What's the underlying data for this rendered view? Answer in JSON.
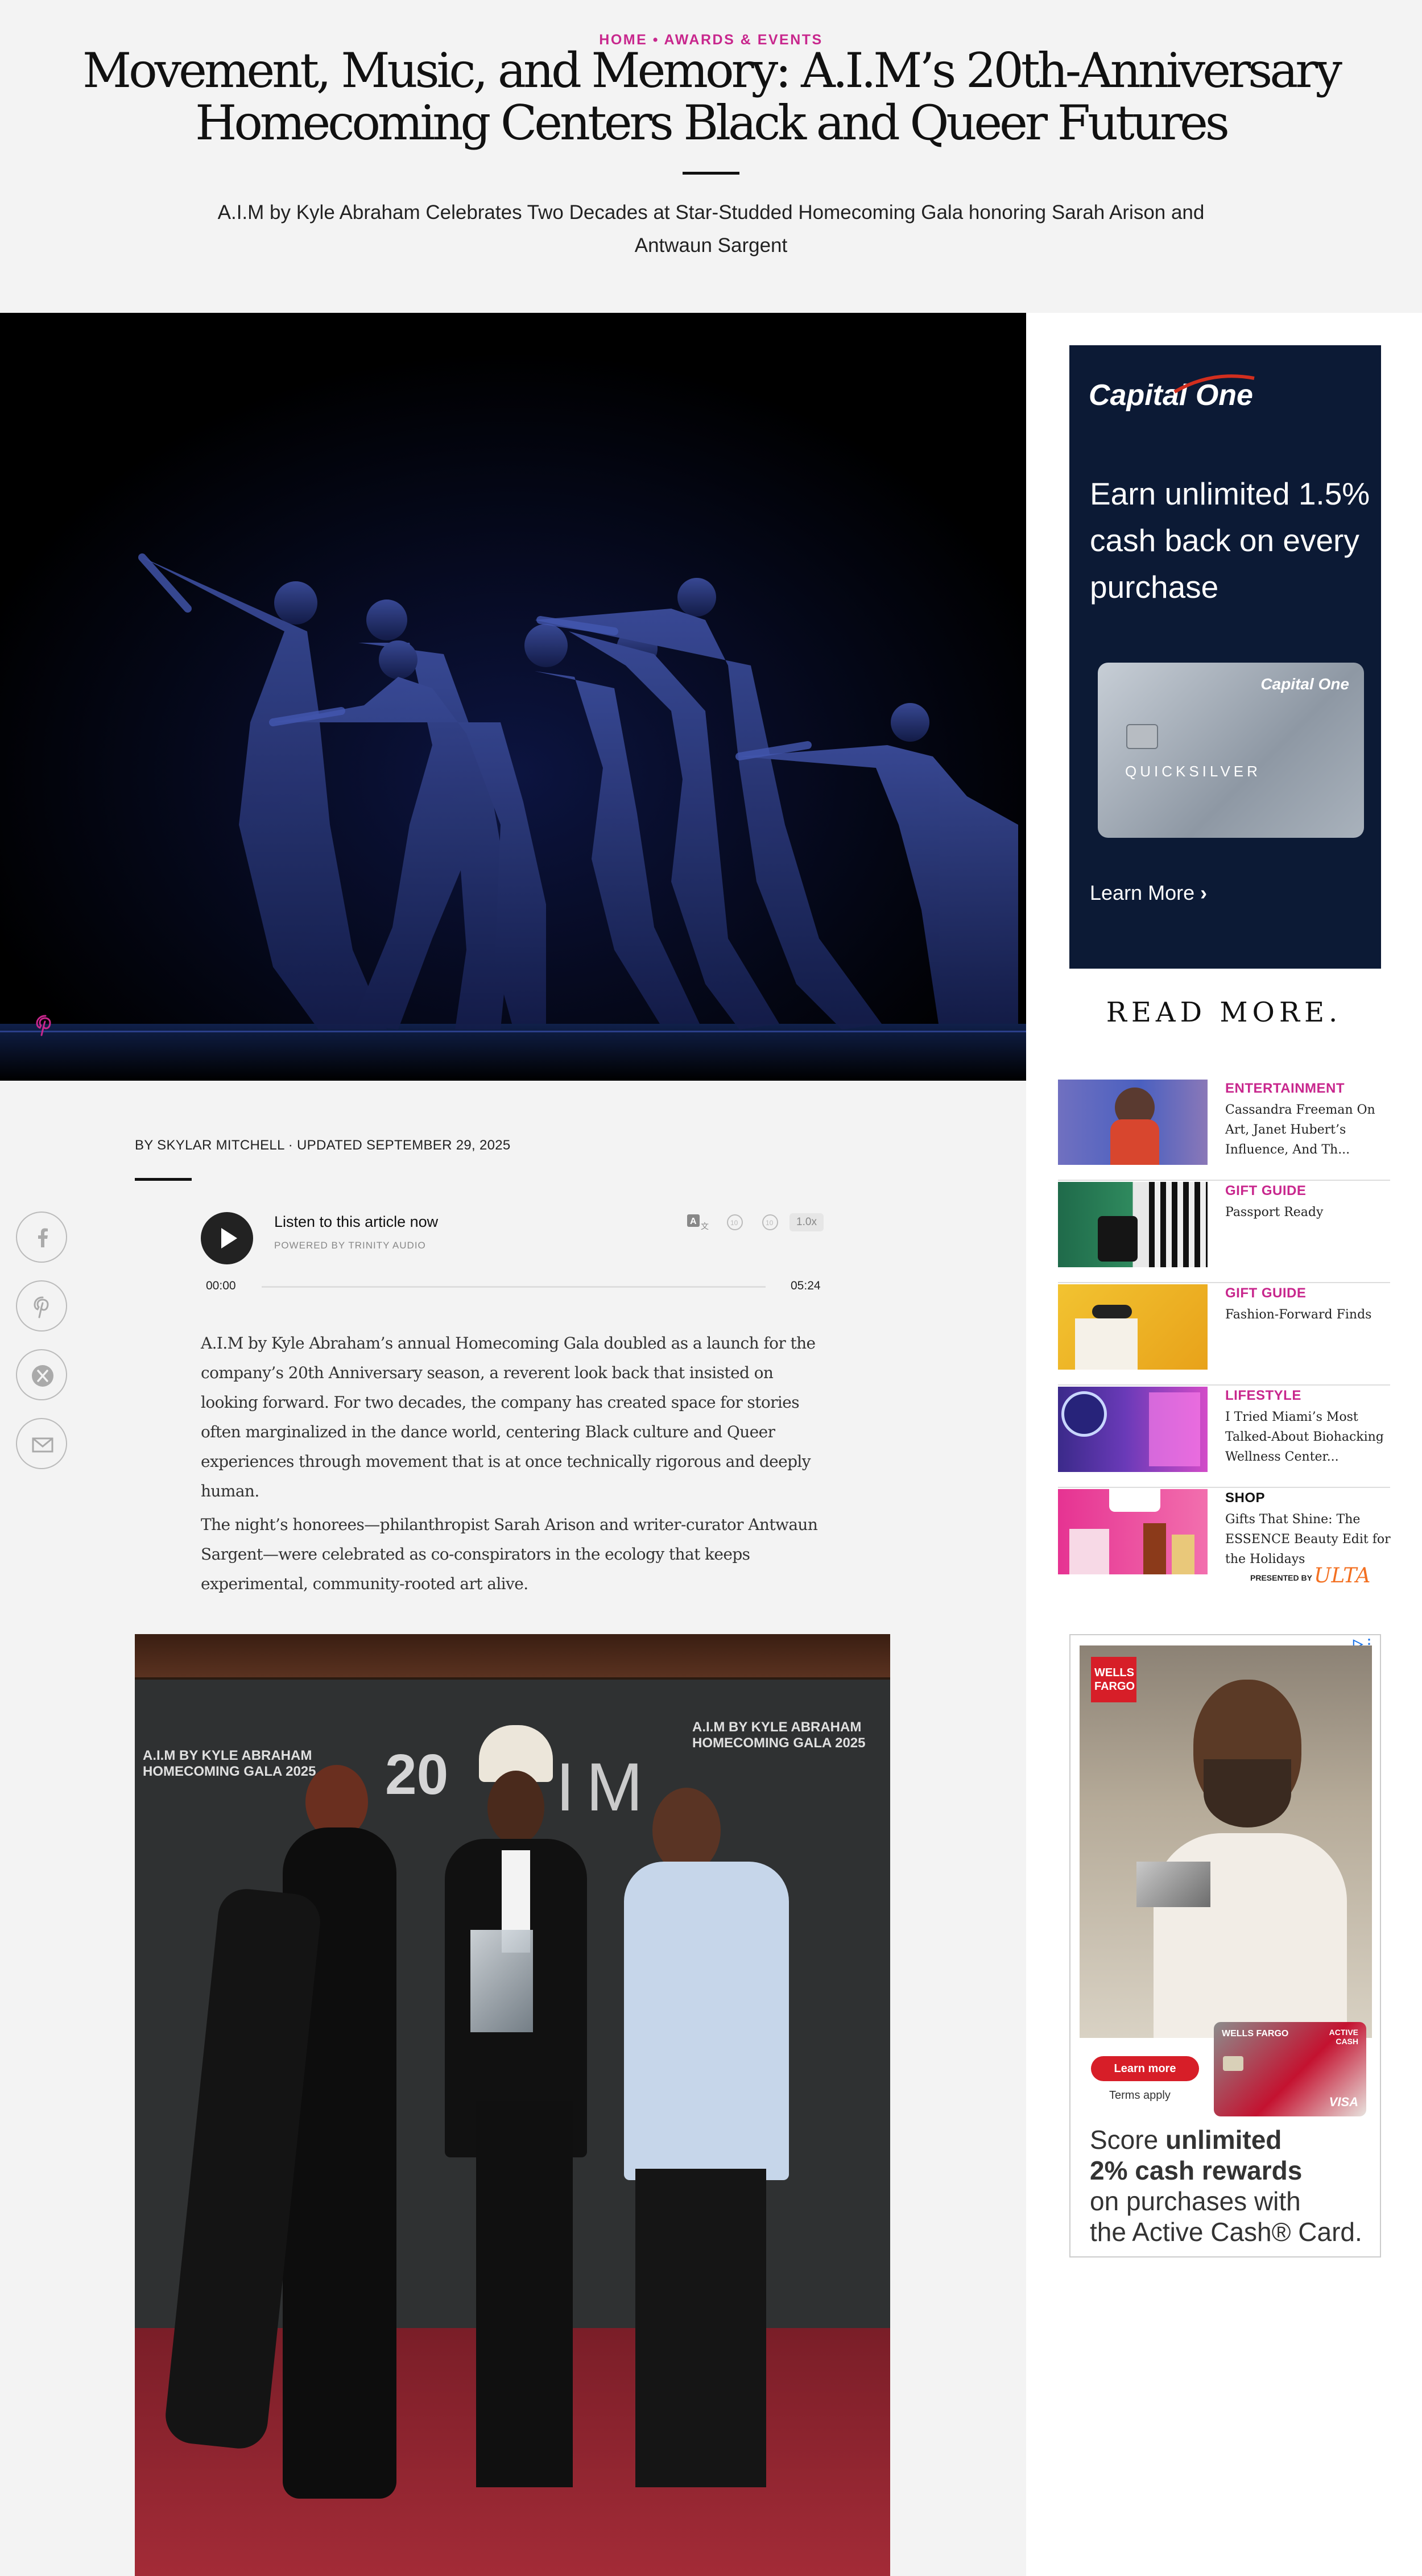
{
  "breadcrumb": {
    "home": "HOME",
    "separator": "•",
    "section": "AWARDS & EVENTS"
  },
  "article": {
    "title": "Movement, Music, and Memory: A.I.M’s 20th-Anniversary Homecoming Centers Black and Queer Futures",
    "subtitle": "A.I.M by Kyle Abraham Celebrates Two Decades at Star-Studded Homecoming Gala honoring Sarah Arison and Antwaun Sargent",
    "byline": "BY SKYLAR MITCHELL · UPDATED SEPTEMBER 29, 2025",
    "paragraphs": [
      "A.I.M by Kyle Abraham’s annual Homecoming Gala doubled as a launch for the company’s 20th Anniversary season, a reverent look back that insisted on looking forward. For two decades, the company has created space for stories often marginalized in the dance world, centering Black culture and Queer experiences through movement that is at once technically rigorous and deeply human.",
      "The night’s honorees—philanthropist Sarah Arison and writer-curator Antwaun Sargent—were celebrated as co-conspirators in the ecology that keeps experimental, community-rooted art alive."
    ]
  },
  "audio_player": {
    "title": "Listen to this article now",
    "powered_by": "POWERED BY  TRINITY AUDIO",
    "current_time": "00:00",
    "duration": "05:24",
    "progress": 0,
    "speed": "1.0x",
    "rewind": "10",
    "forward": "10"
  },
  "social": [
    "facebook-icon",
    "pinterest-icon",
    "x-icon",
    "email-icon"
  ],
  "ad_capital_one": {
    "logo": "Capital One",
    "headline": "Earn unlimited 1.5% cash back on every purchase",
    "card_brand": "Capital One",
    "card_name": "QUICKSILVER",
    "cta": "Learn More"
  },
  "read_more": {
    "heading": "READ MORE.",
    "items": [
      {
        "category": "ENTERTAINMENT",
        "text": "Cassandra Freeman On Art, Janet Hubert’s Influence, And Th..."
      },
      {
        "category": "GIFT GUIDE",
        "text": "Passport Ready"
      },
      {
        "category": "GIFT GUIDE",
        "text": "Fashion-Forward Finds"
      },
      {
        "category": "LIFESTYLE",
        "text": "I Tried Miami’s Most Talked-About Biohacking Wellness Center..."
      },
      {
        "category": "SHOP",
        "text": "Gifts That Shine: The ESSENCE Beauty Edit for the Holidays",
        "sponsor_label": "PRESENTED BY",
        "sponsor": "ULTA"
      }
    ]
  },
  "ad_wells_fargo": {
    "logo_line1": "WELLS",
    "logo_line2": "FARGO",
    "cta": "Learn more",
    "terms": "Terms apply",
    "card_brand": "WELLS FARGO",
    "card_badge": "ACTIVE CASH",
    "card_network": "VISA",
    "headline_1": "Score ",
    "headline_bold_1": "unlimited",
    "headline_bold_2": "2% cash rewards",
    "headline_2": "on purchases with",
    "headline_3": "the Active Cash® Card."
  },
  "photo2": {
    "backdrop_brand": "A.I.M BY KYLE ABRAHAM",
    "backdrop_event": "HOMECOMING GALA 2025",
    "backdrop_number": "20",
    "backdrop_logo": "AIM"
  },
  "colors": {
    "accent": "#c8278d",
    "capital_one_bg": "#0c1a35",
    "wf_red": "#d71e28"
  }
}
